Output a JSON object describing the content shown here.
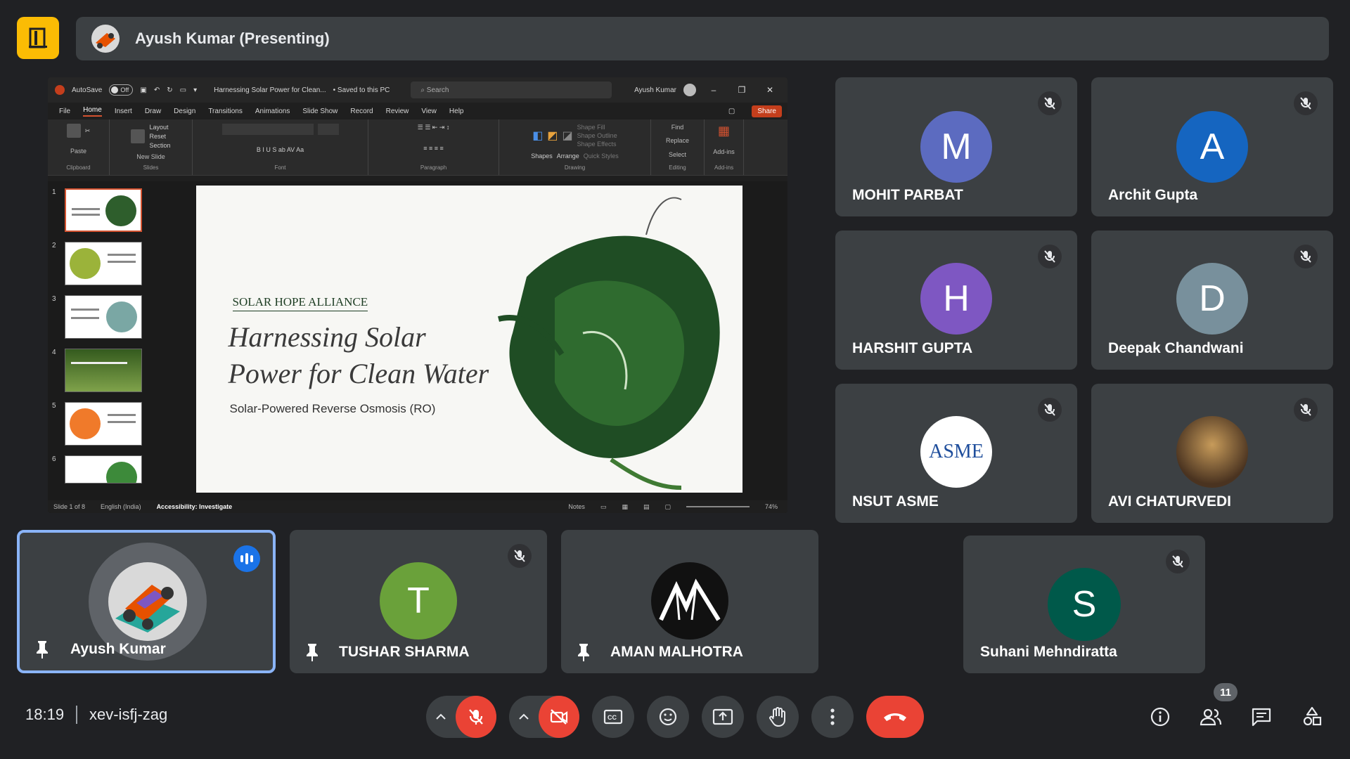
{
  "presenting_banner": {
    "label": "Ayush Kumar (Presenting)"
  },
  "ppt": {
    "autosave_label": "AutoSave",
    "autosave_state": "Off",
    "doc_title": "Harnessing Solar Power for Clean...",
    "saved_state": "• Saved to this PC",
    "search_placeholder": "Search",
    "user_name": "Ayush Kumar",
    "menus": [
      "File",
      "Home",
      "Insert",
      "Draw",
      "Design",
      "Transitions",
      "Animations",
      "Slide Show",
      "Record",
      "Review",
      "View",
      "Help"
    ],
    "share_label": "Share",
    "ribbon": {
      "paste": "Paste",
      "clipboard": "Clipboard",
      "new_slide": "New Slide",
      "layout": "Layout",
      "reset": "Reset",
      "section": "Section",
      "slides": "Slides",
      "font": "Font",
      "paragraph": "Paragraph",
      "shapes": "Shapes",
      "arrange": "Arrange",
      "quick_styles": "Quick Styles",
      "shape_fill": "Shape Fill",
      "shape_outline": "Shape Outline",
      "shape_effects": "Shape Effects",
      "drawing": "Drawing",
      "find": "Find",
      "replace": "Replace",
      "select": "Select",
      "editing": "Editing",
      "addins": "Add-ins",
      "addins_group": "Add-ins"
    },
    "thumb_numbers": [
      "1",
      "2",
      "3",
      "4",
      "5",
      "6"
    ],
    "slide": {
      "org": "SOLAR HOPE ALLIANCE",
      "title": "Harnessing Solar Power for Clean Water",
      "subtitle": "Solar-Powered Reverse Osmosis (RO)"
    },
    "status": {
      "slide_of": "Slide 1 of 8",
      "language": "English (India)",
      "accessibility": "Accessibility: Investigate",
      "notes": "Notes",
      "zoom": "74%"
    }
  },
  "participants": [
    {
      "name": "MOHIT PARBAT",
      "initial": "M",
      "color": "#5c6bc0"
    },
    {
      "name": "Archit Gupta",
      "initial": "A",
      "color": "#1565c0"
    },
    {
      "name": "HARSHIT GUPTA",
      "initial": "H",
      "color": "#7e57c2"
    },
    {
      "name": "Deepak Chandwani",
      "initial": "D",
      "color": "#78909c"
    },
    {
      "name": "NSUT ASME",
      "initial": "",
      "color": "#ffffff"
    },
    {
      "name": "AVI CHATURVEDI",
      "initial": "",
      "color": "#6d4c41"
    },
    {
      "name": "Ayush Kumar",
      "initial": "",
      "color": "#5f6368"
    },
    {
      "name": "TUSHAR SHARMA",
      "initial": "T",
      "color": "#6aa13a"
    },
    {
      "name": "AMAN MALHOTRA",
      "initial": "",
      "color": "#111111"
    },
    {
      "name": "Suhani Mehndiratta",
      "initial": "S",
      "color": "#00594a"
    }
  ],
  "asme_logo_text": "ASME",
  "bottom": {
    "time": "18:19",
    "meeting_code": "xev-isfj-zag",
    "participant_count": "11"
  }
}
